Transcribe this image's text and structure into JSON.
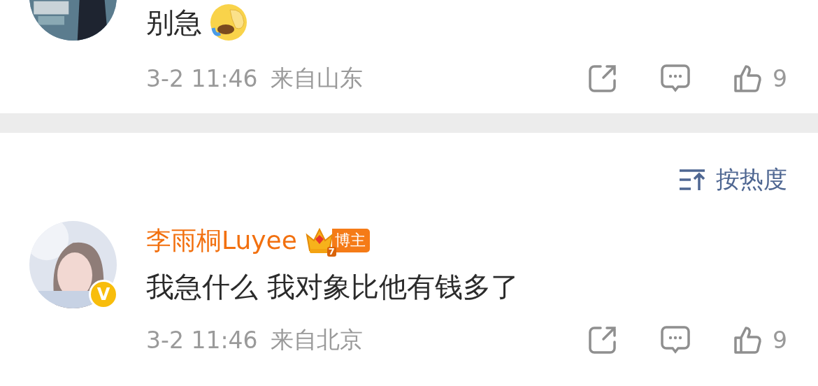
{
  "comments": [
    {
      "kind": "reply",
      "text": "别急",
      "meta_time": "3-2 11:46",
      "meta_location": "来自山东",
      "likes": "9"
    },
    {
      "kind": "top",
      "author": "李雨桐Luyee",
      "badge_level": "7",
      "badge_label": "博主",
      "verified_badge": "V",
      "text": "我急什么 我对象比他有钱多了",
      "meta_time": "3-2 11:46",
      "meta_location": "来自北京",
      "likes": "9",
      "verified": true
    }
  ],
  "sort": {
    "label": "按热度"
  }
}
